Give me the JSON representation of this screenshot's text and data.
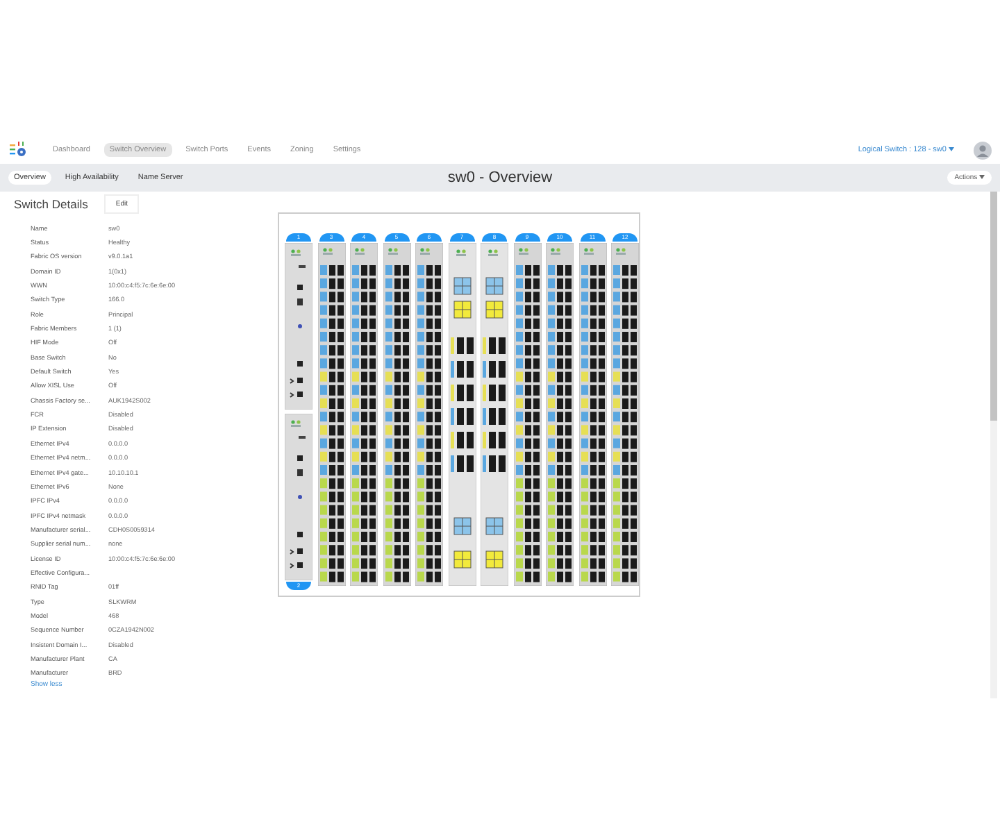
{
  "nav": {
    "items": [
      {
        "label": "Dashboard",
        "selected": false
      },
      {
        "label": "Switch Overview",
        "selected": true
      },
      {
        "label": "Switch Ports",
        "selected": false
      },
      {
        "label": "Events",
        "selected": false
      },
      {
        "label": "Zoning",
        "selected": false
      },
      {
        "label": "Settings",
        "selected": false
      }
    ],
    "logical_switch": "Logical Switch : 128 - sw0"
  },
  "subnav": {
    "tabs": [
      {
        "label": "Overview",
        "selected": true
      },
      {
        "label": "High Availability",
        "selected": false
      },
      {
        "label": "Name Server",
        "selected": false
      }
    ],
    "title": "sw0 - Overview",
    "actions": "Actions"
  },
  "switch_details": {
    "title": "Switch Details",
    "edit": "Edit",
    "fields": [
      {
        "label": "Name",
        "value": "sw0"
      },
      {
        "label": "Status",
        "value": "Healthy"
      },
      {
        "label": "Fabric OS version",
        "value": "v9.0.1a1"
      },
      {
        "label": "Domain ID",
        "value": "1(0x1)"
      },
      {
        "label": "WWN",
        "value": "10:00:c4:f5:7c:6e:6e:00"
      },
      {
        "label": "Switch Type",
        "value": "166.0"
      },
      {
        "label": "Role",
        "value": "Principal"
      },
      {
        "label": "Fabric Members",
        "value": "1 (1)"
      },
      {
        "label": "HIF Mode",
        "value": "Off"
      },
      {
        "label": "Base Switch",
        "value": "No"
      },
      {
        "label": "Default Switch",
        "value": "Yes"
      },
      {
        "label": "Allow XISL Use",
        "value": "Off"
      },
      {
        "label": "Chassis Factory se...",
        "value": "AUK1942S002"
      },
      {
        "label": "FCR",
        "value": "Disabled"
      },
      {
        "label": "IP Extension",
        "value": "Disabled"
      },
      {
        "label": "Ethernet IPv4",
        "value": "0.0.0.0"
      },
      {
        "label": "Ethernet IPv4 netm...",
        "value": "0.0.0.0"
      },
      {
        "label": "Ethernet IPv4 gate...",
        "value": "10.10.10.1"
      },
      {
        "label": "Ethernet IPv6",
        "value": "None"
      },
      {
        "label": "IPFC IPv4",
        "value": "0.0.0.0"
      },
      {
        "label": "IPFC IPv4 netmask",
        "value": "0.0.0.0"
      },
      {
        "label": "Manufacturer serial...",
        "value": "CDH0S0059314"
      },
      {
        "label": "Supplier serial num...",
        "value": "none"
      },
      {
        "label": "License ID",
        "value": "10:00:c4:f5:7c:6e:6e:00"
      },
      {
        "label": "Effective Configura..."
      },
      {
        "label": "RNID Tag",
        "value": "01ff"
      },
      {
        "label": "Type",
        "value": "SLKWRM"
      },
      {
        "label": "Model",
        "value": "468"
      },
      {
        "label": "Sequence Number",
        "value": "0CZA1942N002"
      },
      {
        "label": "Insistent Domain I...",
        "value": "Disabled"
      },
      {
        "label": "Manufacturer Plant",
        "value": "CA"
      },
      {
        "label": "Manufacturer",
        "value": "BRD"
      }
    ],
    "show_less": "Show less"
  },
  "chassis": {
    "slots": [
      {
        "kind": "cp",
        "number": "1",
        "bottom_number": "2"
      },
      {
        "kind": "port",
        "number": "3"
      },
      {
        "kind": "port",
        "number": "4"
      },
      {
        "kind": "port",
        "number": "5"
      },
      {
        "kind": "port",
        "number": "6"
      },
      {
        "kind": "core",
        "number": "7"
      },
      {
        "kind": "core",
        "number": "8"
      },
      {
        "kind": "port",
        "number": "9"
      },
      {
        "kind": "port",
        "number": "10"
      },
      {
        "kind": "port",
        "number": "11"
      },
      {
        "kind": "port",
        "number": "12"
      }
    ]
  }
}
